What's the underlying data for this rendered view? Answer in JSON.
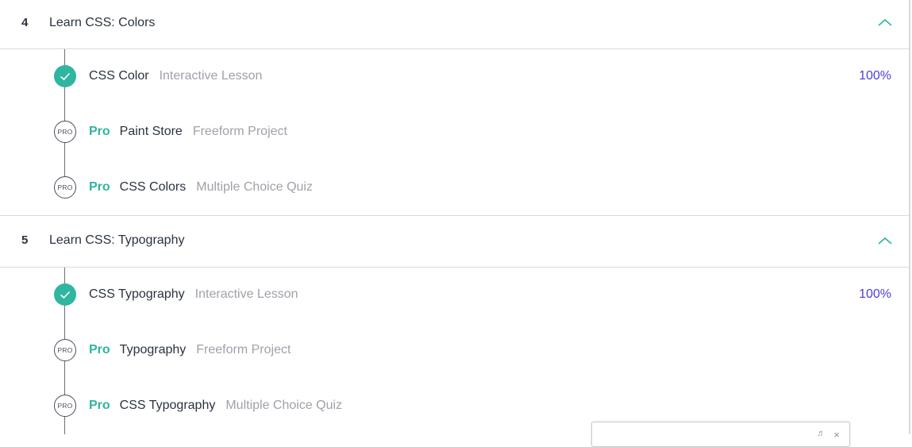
{
  "modules": [
    {
      "number": "4",
      "title": "Learn CSS: Colors",
      "lessons": [
        {
          "pro": "",
          "title": "CSS Color",
          "type": "Interactive Lesson",
          "percent": "100%"
        },
        {
          "pro": "Pro",
          "title": "Paint Store",
          "type": "Freeform Project",
          "percent": ""
        },
        {
          "pro": "Pro",
          "title": "CSS Colors",
          "type": "Multiple Choice Quiz",
          "percent": ""
        }
      ]
    },
    {
      "number": "5",
      "title": "Learn CSS: Typography",
      "lessons": [
        {
          "pro": "",
          "title": "CSS Typography",
          "type": "Interactive Lesson",
          "percent": "100%"
        },
        {
          "pro": "Pro",
          "title": "Typography",
          "type": "Freeform Project",
          "percent": ""
        },
        {
          "pro": "Pro",
          "title": "CSS Typography",
          "type": "Multiple Choice Quiz",
          "percent": ""
        }
      ]
    }
  ],
  "pro_badge": "PRO",
  "popup": {
    "text": "",
    "close": "×"
  },
  "colors": {
    "accent": "#2fb5a0",
    "percent": "#4b3fd6",
    "muted": "#9ea1a8"
  }
}
